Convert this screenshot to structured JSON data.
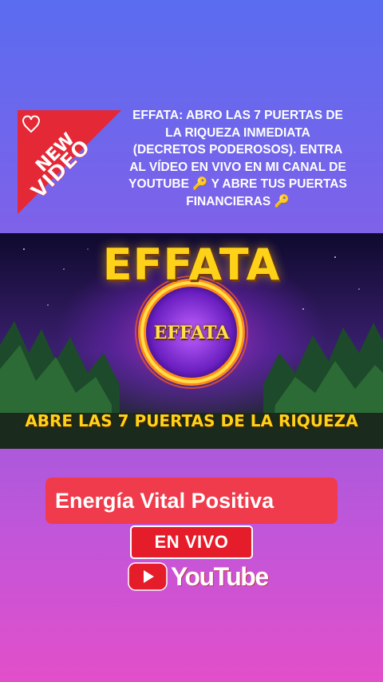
{
  "badge": {
    "line1": "NEW",
    "line2": "VIDEO"
  },
  "headline": "EFFATA: ABRO LAS 7 PUERTAS DE LA RIQUEZA INMEDIATA (DECRETOS PODEROSOS). ENTRA AL VÍDEO EN VIVO EN MI CANAL DE YOUTUBE 🔑 Y ABRE TUS PUERTAS FINANCIERAS 🔑",
  "thumbnail": {
    "title": "EFFATA",
    "ring_label": "EFFATA",
    "subtitle": "ABRE LAS 7 PUERTAS DE LA RIQUEZA"
  },
  "channel_name": "Energía Vital Positiva",
  "live_label": "EN VIVO",
  "youtube_word": "YouTube",
  "colors": {
    "channel_bg": "#ef3b4b",
    "live_bg": "#e51c2a",
    "gold_text": "#ffd21a",
    "badge_red": "#e52835"
  }
}
